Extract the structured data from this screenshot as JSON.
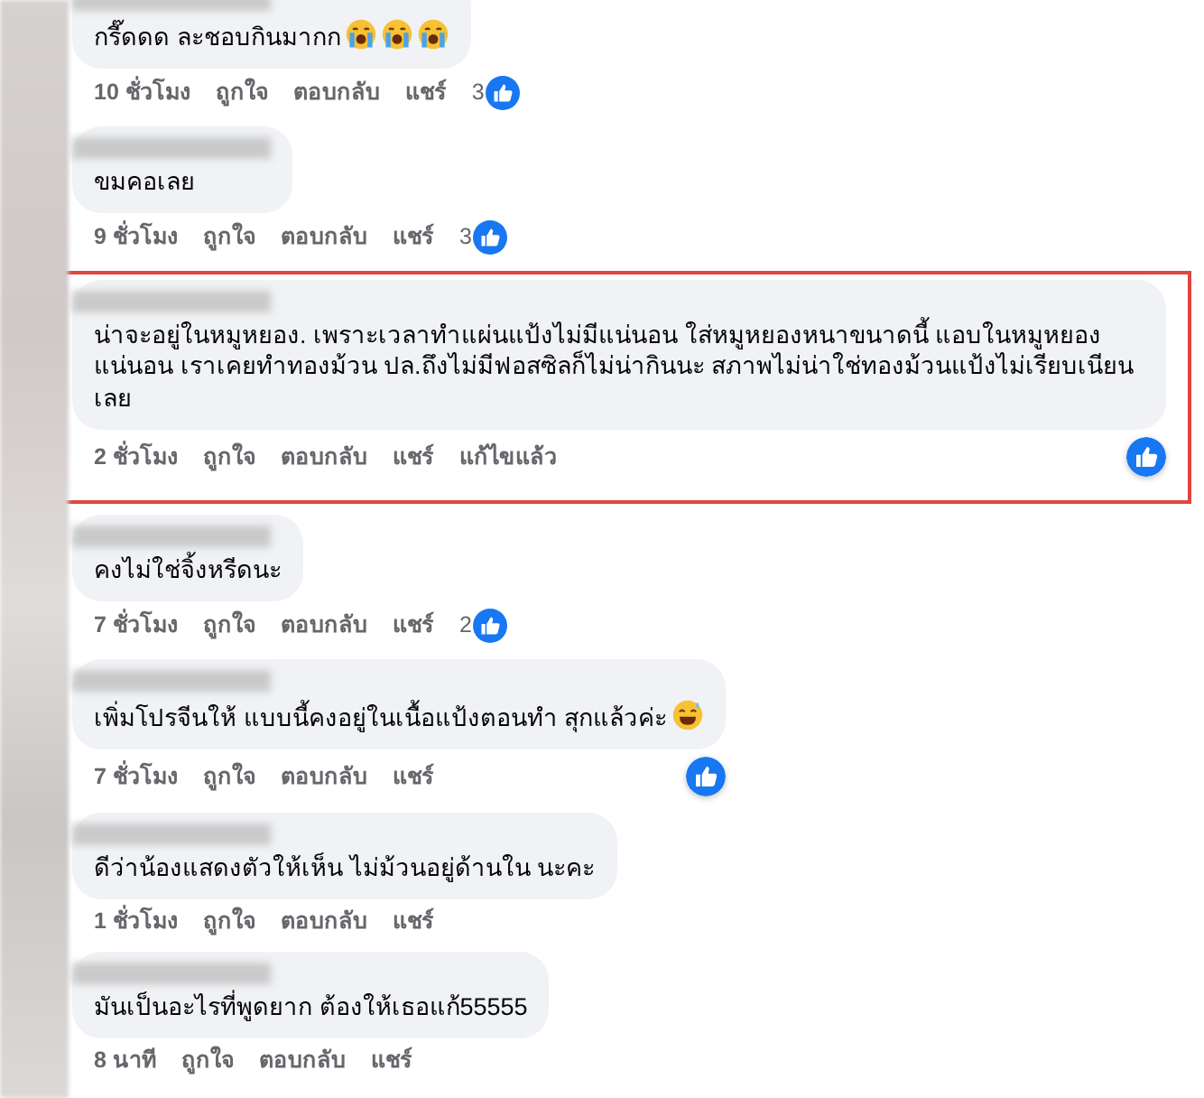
{
  "comments": [
    {
      "text": "กรี๊ดดด ละชอบกินมากก",
      "emojis": [
        {
          "kind": "crying"
        },
        {
          "kind": "crying"
        },
        {
          "kind": "crying"
        }
      ],
      "time": "10 ชั่วโมง",
      "actions": [
        "ถูกใจ",
        "ตอบกลับ",
        "แชร์"
      ],
      "reactions": {
        "count": "3",
        "at_bubble_edge": false
      },
      "highlighted": false
    },
    {
      "text": "ขมคอเลย",
      "time": "9 ชั่วโมง",
      "actions": [
        "ถูกใจ",
        "ตอบกลับ",
        "แชร์"
      ],
      "reactions": {
        "count": "3",
        "at_bubble_edge": false
      },
      "highlighted": false
    },
    {
      "text": "น่าจะอยู่ในหมูหยอง. เพราะเวลาทำแผ่นแป้งไม่มีแน่นอน ใส่หมูหยองหนาขนาดนี้ แอบในหมูหยองแน่นอน เราเคยทำทองม้วน ปล.ถึงไม่มีฟอสซิลก็ไม่น่ากินนะ สภาพไม่น่าใช่ทองม้วนแป้งไม่เรียบเนียนเลย",
      "time": "2 ชั่วโมง",
      "actions": [
        "ถูกใจ",
        "ตอบกลับ",
        "แชร์"
      ],
      "edited_label": "แก้ไขแล้ว",
      "reactions": {
        "at_bubble_edge": true
      },
      "highlighted": true
    },
    {
      "text": "คงไม่ใช่จิ้งหรีดนะ",
      "time": "7 ชั่วโมง",
      "actions": [
        "ถูกใจ",
        "ตอบกลับ",
        "แชร์"
      ],
      "reactions": {
        "count": "2",
        "at_bubble_edge": false
      },
      "highlighted": false
    },
    {
      "text": "เพิ่มโปรจีนให้ แบบนี้คงอยู่ในเนื้อแป้งตอนทำ สุกแล้วค่ะ",
      "emojis": [
        {
          "kind": "sweat-smile"
        }
      ],
      "time": "7 ชั่วโมง",
      "actions": [
        "ถูกใจ",
        "ตอบกลับ",
        "แชร์"
      ],
      "reactions": {
        "at_bubble_edge": true
      },
      "highlighted": false
    },
    {
      "text": "ดีว่าน้องแสดงตัวให้เห็น ไม่ม้วนอยู่ด้านใน นะคะ",
      "time": "1 ชั่วโมง",
      "actions": [
        "ถูกใจ",
        "ตอบกลับ",
        "แชร์"
      ],
      "highlighted": false
    },
    {
      "text": "มันเป็นอะไรที่พูดยาก ต้องให้เธอแก้55555",
      "time": "8 นาที",
      "actions": [
        "ถูกใจ",
        "ตอบกลับ",
        "แชร์"
      ],
      "highlighted": false
    }
  ]
}
